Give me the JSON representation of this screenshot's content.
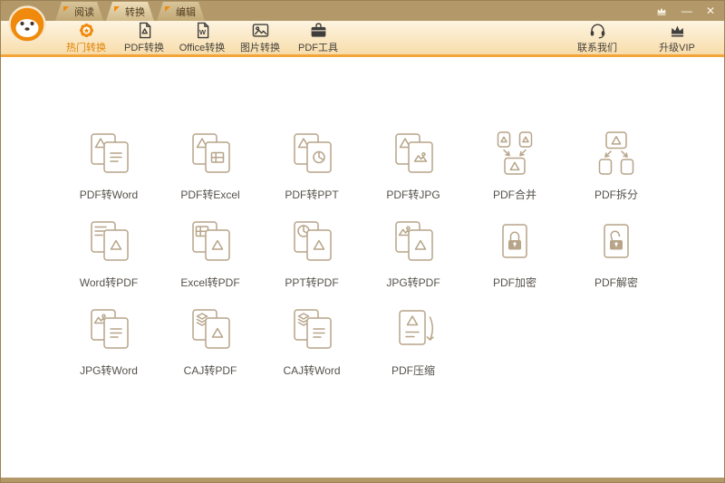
{
  "window": {
    "title_tabs": [
      {
        "key": "read",
        "label": "阅读",
        "active": false
      },
      {
        "key": "convert",
        "label": "转换",
        "active": true
      },
      {
        "key": "edit",
        "label": "编辑",
        "active": false
      }
    ],
    "controls": [
      {
        "key": "vip-skin",
        "type": "crown-icon"
      },
      {
        "key": "minimize",
        "glyph": "—"
      },
      {
        "key": "close",
        "glyph": "✕"
      }
    ]
  },
  "toolbar": {
    "nav": [
      {
        "key": "hot",
        "label": "热门转换",
        "icon": "hot-badge-icon",
        "active": true
      },
      {
        "key": "pdf",
        "label": "PDF转换",
        "icon": "pdf-document-icon",
        "active": false
      },
      {
        "key": "office",
        "label": "Office转换",
        "icon": "office-document-icon",
        "active": false
      },
      {
        "key": "image",
        "label": "图片转换",
        "icon": "image-icon",
        "active": false
      },
      {
        "key": "tools",
        "label": "PDF工具",
        "icon": "briefcase-icon",
        "active": false
      }
    ],
    "actions": [
      {
        "key": "contact",
        "label": "联系我们",
        "icon": "headset-icon"
      },
      {
        "key": "vip",
        "label": "升级VIP",
        "icon": "crown-icon"
      }
    ]
  },
  "grid": {
    "items": [
      {
        "key": "pdf-to-word",
        "label": "PDF转Word",
        "icon": "pdf-to-word-icon"
      },
      {
        "key": "pdf-to-excel",
        "label": "PDF转Excel",
        "icon": "pdf-to-excel-icon"
      },
      {
        "key": "pdf-to-ppt",
        "label": "PDF转PPT",
        "icon": "pdf-to-ppt-icon"
      },
      {
        "key": "pdf-to-jpg",
        "label": "PDF转JPG",
        "icon": "pdf-to-jpg-icon"
      },
      {
        "key": "pdf-merge",
        "label": "PDF合并",
        "icon": "pdf-merge-icon"
      },
      {
        "key": "pdf-split",
        "label": "PDF拆分",
        "icon": "pdf-split-icon"
      },
      {
        "key": "word-to-pdf",
        "label": "Word转PDF",
        "icon": "word-to-pdf-icon"
      },
      {
        "key": "excel-to-pdf",
        "label": "Excel转PDF",
        "icon": "excel-to-pdf-icon"
      },
      {
        "key": "ppt-to-pdf",
        "label": "PPT转PDF",
        "icon": "ppt-to-pdf-icon"
      },
      {
        "key": "jpg-to-pdf",
        "label": "JPG转PDF",
        "icon": "jpg-to-pdf-icon"
      },
      {
        "key": "pdf-encrypt",
        "label": "PDF加密",
        "icon": "pdf-encrypt-icon"
      },
      {
        "key": "pdf-decrypt",
        "label": "PDF解密",
        "icon": "pdf-decrypt-icon"
      },
      {
        "key": "jpg-to-word",
        "label": "JPG转Word",
        "icon": "jpg-to-word-icon"
      },
      {
        "key": "caj-to-pdf",
        "label": "CAJ转PDF",
        "icon": "caj-to-pdf-icon"
      },
      {
        "key": "caj-to-word",
        "label": "CAJ转Word",
        "icon": "caj-to-word-icon"
      },
      {
        "key": "pdf-compress",
        "label": "PDF压缩",
        "icon": "pdf-compress-icon"
      }
    ]
  },
  "colors": {
    "titlebar": "#b3996a",
    "accent_orange": "#f08a0c",
    "toolbar_border": "#f3a53a",
    "toolbar_icon": "#3f3e3c",
    "icon_stroke": "#b7a489",
    "label_text": "#56524c"
  }
}
